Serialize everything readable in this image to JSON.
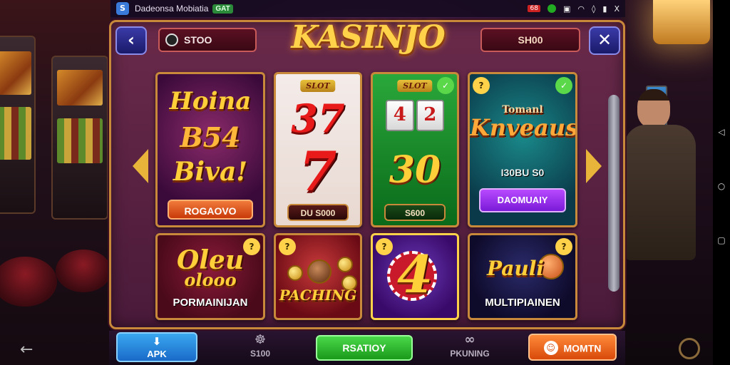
{
  "status_bar": {
    "app_icon_glyph": "S",
    "app_name": "Dadeonsa Mobiatia",
    "badge": "GAT",
    "icons": [
      "notification-red-icon",
      "whatsapp-icon",
      "message-icon",
      "wifi-icon",
      "mute-icon",
      "signal-icon",
      "close-x-icon"
    ],
    "red_chip": "68",
    "close_glyph": "X"
  },
  "header": {
    "back_glyph": "‹",
    "left_pill_text": "STOO",
    "logo": "KASINJO",
    "right_pill_text": "SH00",
    "close_glyph": "✕"
  },
  "tiles": [
    {
      "title_lines": [
        "Hoina",
        "B54",
        "Biva!"
      ],
      "button": "ROGAOVO",
      "button_color": "#e0562a"
    },
    {
      "tag": "SLOT",
      "big_top": "37",
      "big_mid": "7",
      "pill": "DU S000"
    },
    {
      "tag": "SLOT",
      "reels": [
        "4",
        "2"
      ],
      "big_mid": "30",
      "pill": "S600"
    },
    {
      "title": "Knveaus",
      "subtitle": "Tomanl",
      "amount": "I30BU S0",
      "button": "DAOMUAIY",
      "button_color": "#8a2ad8"
    },
    {
      "big": "Oleu",
      "big2": "olooo",
      "label": "PORMAINIJAN",
      "badge": "?"
    },
    {
      "label": "PACHING",
      "badge": "?"
    },
    {
      "big": "4",
      "badge": "?"
    },
    {
      "big": "Pauli",
      "label": "MULTIPIAINEN",
      "badge": "?"
    }
  ],
  "bottom_nav": {
    "apk_label": "APK",
    "slot_label": "S100",
    "green_label": "RSATIOY",
    "ping_label": "PKUNING",
    "orange_label": "MOMTN"
  },
  "colors": {
    "accent_gold": "#ffd24a",
    "frame_border": "#c88a3a"
  }
}
